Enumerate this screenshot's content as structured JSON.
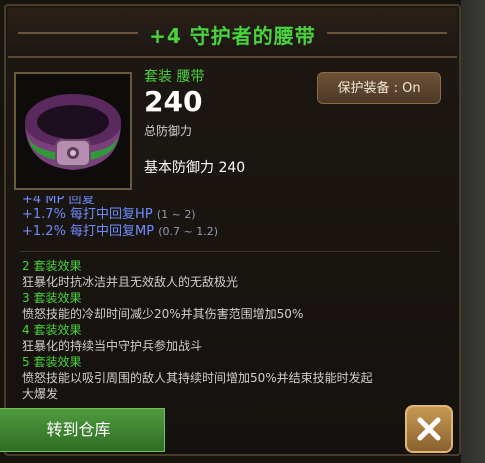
{
  "window": {
    "title": "+4 守护者的腰带"
  },
  "item": {
    "type_label": "套装 腰带",
    "defense_value": "240",
    "defense_label": "总防御力",
    "base_defense": "基本防御力 240",
    "icon": "belt-icon"
  },
  "protect_button": {
    "label": "保护装备 : On"
  },
  "stats": [
    {
      "text": "+1.7% 每打中回复HP",
      "range": "(1 ~ 2)"
    },
    {
      "text": "+1.2% 每打中回复MP",
      "range": "(0.7 ~ 1.2)"
    }
  ],
  "sets": [
    {
      "title": "2 套装效果",
      "desc": "狂暴化时抗冰洁并且无效敌人的无敌极光"
    },
    {
      "title": "3 套装效果",
      "desc": "愤怒技能的冷却时间减少20%并其伤害范围增加50%"
    },
    {
      "title": "4 套装效果",
      "desc": "狂暴化的持续当中守护兵参加战斗"
    },
    {
      "title": "5 套装效果",
      "desc": "愤怒技能以吸引周围的敌人其持续时间增加50%并结束技能时发起"
    }
  ],
  "set_extra": "大爆发",
  "footer": {
    "transfer_label": "转到仓库",
    "close_icon": "close-icon"
  },
  "colors": {
    "title_green": "#49d33d",
    "stat_blue": "#6f8cff",
    "accent_brown": "#6e5237"
  }
}
